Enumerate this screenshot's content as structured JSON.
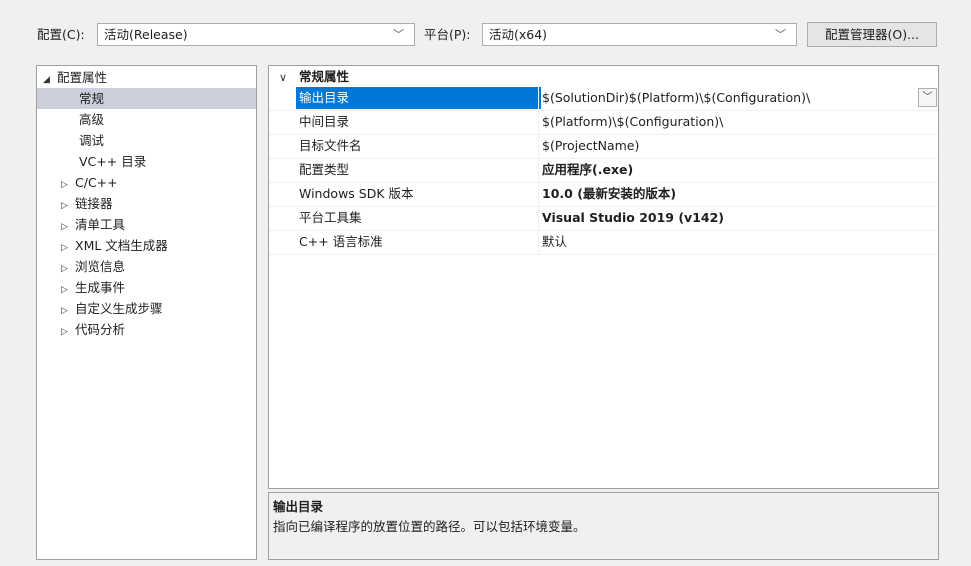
{
  "toolbar": {
    "config_label": "配置(C):",
    "config_value": "活动(Release)",
    "platform_label": "平台(P):",
    "platform_value": "活动(x64)",
    "config_manager_button": "配置管理器(O)..."
  },
  "tree": {
    "root": {
      "label": "配置属性",
      "glyph": "◢"
    },
    "items": [
      {
        "label": "常规"
      },
      {
        "label": "高级"
      },
      {
        "label": "调试"
      },
      {
        "label": "VC++ 目录"
      },
      {
        "label": "C/C++",
        "glyph": "▷"
      },
      {
        "label": "链接器",
        "glyph": "▷"
      },
      {
        "label": "清单工具",
        "glyph": "▷"
      },
      {
        "label": "XML 文档生成器",
        "glyph": "▷"
      },
      {
        "label": "浏览信息",
        "glyph": "▷"
      },
      {
        "label": "生成事件",
        "glyph": "▷"
      },
      {
        "label": "自定义生成步骤",
        "glyph": "▷"
      },
      {
        "label": "代码分析",
        "glyph": "▷"
      }
    ]
  },
  "grid": {
    "category": "常规属性",
    "rows": [
      {
        "name": "输出目录",
        "value": "$(SolutionDir)$(Platform)\\$(Configuration)\\"
      },
      {
        "name": "中间目录",
        "value": "$(Platform)\\$(Configuration)\\"
      },
      {
        "name": "目标文件名",
        "value": "$(ProjectName)"
      },
      {
        "name": "配置类型",
        "value": "应用程序(.exe)"
      },
      {
        "name": "Windows SDK 版本",
        "value": "10.0 (最新安装的版本)"
      },
      {
        "name": "平台工具集",
        "value": "Visual Studio 2019 (v142)"
      },
      {
        "name": "C++ 语言标准",
        "value": "默认"
      }
    ]
  },
  "description": {
    "title": "输出目录",
    "text": "指向已编译程序的放置位置的路径。可以包括环境变量。"
  },
  "colors": {
    "selection": "#0078d7",
    "tree_selection": "#cccedb"
  }
}
